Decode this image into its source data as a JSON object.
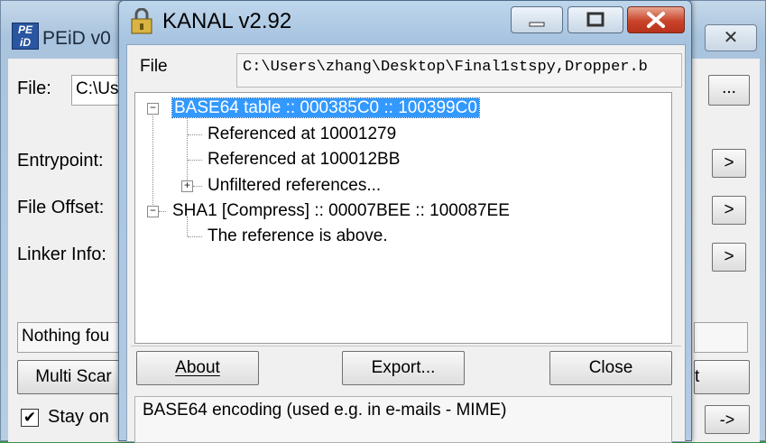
{
  "peid": {
    "title": "PEiD v0",
    "logo_text": "PE iD",
    "file_label": "File:",
    "file_value": "C:\\Us",
    "browse_label": "...",
    "entrypoint_label": "Entrypoint:",
    "file_offset_label": "File Offset:",
    "linker_info_label": "Linker Info:",
    "arrow_label": ">",
    "status_text": "Nothing fou",
    "multi_scan_label": "Multi Scar",
    "right_button_label": "t",
    "stay_on_label": "Stay on",
    "bottom_arrow_label": "->",
    "close_glyph": "✕"
  },
  "kanal": {
    "title": "KANAL v2.92",
    "file_label": "File",
    "file_value": "C:\\Users\\zhang\\Desktop\\Final1stspy,Dropper.b",
    "tree": {
      "node1": "BASE64 table :: 000385C0 :: 100399C0",
      "node1_child1": "Referenced at 10001279",
      "node1_child2": "Referenced at 100012BB",
      "node1_child3": "Unfiltered references...",
      "node2": "SHA1 [Compress] :: 00007BEE :: 100087EE",
      "node2_child1": "The reference is above."
    },
    "buttons": {
      "about": "About",
      "export": "Export...",
      "close": "Close"
    },
    "status": "BASE64 encoding (used e.g. in e-mails - MIME)"
  },
  "colors": {
    "selection": "#3399ff",
    "close_button": "#c9442a"
  }
}
